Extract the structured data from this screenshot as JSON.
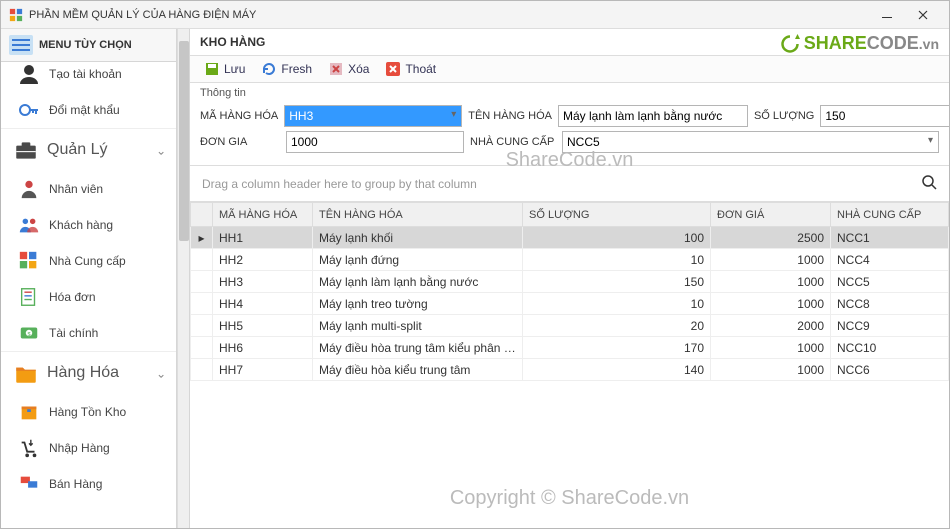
{
  "window": {
    "title": "PHẦN MỀM QUẢN LÝ CỦA HÀNG ĐIỆN MÁY"
  },
  "brand": {
    "share": "SHARE",
    "code": "CODE",
    "vn": ".vn"
  },
  "watermark1": "ShareCode.vn",
  "watermark2": "Copyright © ShareCode.vn",
  "sidebar": {
    "menu_label": "MENU TÙY CHỌN",
    "top": [
      {
        "label": "Tạo tài khoản"
      },
      {
        "label": "Đổi mật khẩu"
      }
    ],
    "sect_manage": "Quản Lý",
    "manage": [
      {
        "label": "Nhân viên"
      },
      {
        "label": "Khách hàng"
      },
      {
        "label": "Nhà Cung cấp"
      },
      {
        "label": "Hóa đơn"
      },
      {
        "label": "Tài chính"
      }
    ],
    "sect_goods": "Hàng Hóa",
    "goods": [
      {
        "label": "Hàng Tồn Kho"
      },
      {
        "label": "Nhập Hàng"
      },
      {
        "label": "Bán Hàng"
      }
    ]
  },
  "panel": {
    "title": "KHO HÀNG",
    "toolbar": {
      "save": "Lưu",
      "refresh": "Fresh",
      "delete": "Xóa",
      "exit": "Thoát"
    },
    "form": {
      "legend": "Thông tin",
      "code_label": "MÃ HÀNG HÓA",
      "code_value": "HH3",
      "name_label": "TÊN HÀNG HÓA",
      "name_value": "Máy lạnh làm lạnh bằng nước",
      "qty_label": "SỐ LƯỢNG",
      "qty_value": "150",
      "price_label": "ĐƠN GIA",
      "price_value": "1000",
      "supplier_label": "NHÀ CUNG CẤP",
      "supplier_value": "NCC5"
    },
    "group_hint": "Drag a column header here to group by that column",
    "columns": {
      "code": "MÃ HÀNG HÓA",
      "name": "TÊN HÀNG HÓA",
      "qty": "SỐ LƯỢNG",
      "price": "ĐƠN GIÁ",
      "supplier": "NHÀ CUNG CẤP"
    },
    "rows": [
      {
        "code": "HH1",
        "name": "Máy lạnh khối",
        "qty": 100,
        "price": 2500,
        "supplier": "NCC1",
        "sel": true
      },
      {
        "code": "HH2",
        "name": "Máy lạnh đứng",
        "qty": 10,
        "price": 1000,
        "supplier": "NCC4"
      },
      {
        "code": "HH3",
        "name": "Máy lạnh làm lạnh bằng nước",
        "qty": 150,
        "price": 1000,
        "supplier": "NCC5"
      },
      {
        "code": "HH4",
        "name": "Máy lạnh treo tường",
        "qty": 10,
        "price": 1000,
        "supplier": "NCC8"
      },
      {
        "code": "HH5",
        "name": "Máy lạnh multi-split",
        "qty": 20,
        "price": 2000,
        "supplier": "NCC9"
      },
      {
        "code": "HH6",
        "name": "Máy điều hòa trung tâm kiểu phân tán",
        "qty": 170,
        "price": 1000,
        "supplier": "NCC10"
      },
      {
        "code": "HH7",
        "name": "Máy điều hòa kiểu trung tâm",
        "qty": 140,
        "price": 1000,
        "supplier": "NCC6"
      }
    ]
  }
}
